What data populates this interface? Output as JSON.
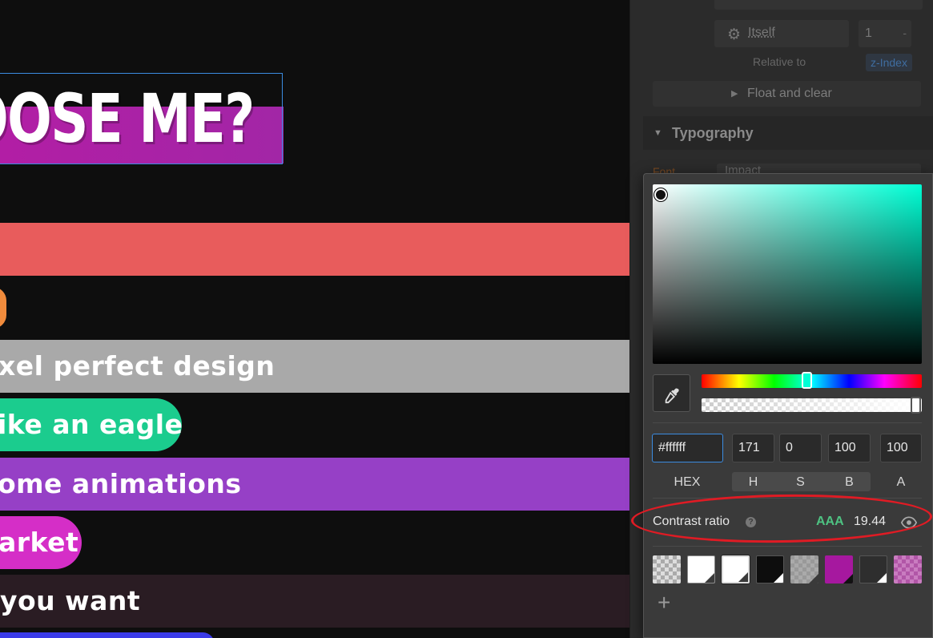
{
  "canvas": {
    "heading": "OOSE ME?",
    "bars": [
      {
        "id": "red",
        "text": ""
      },
      {
        "id": "gray",
        "text": "xel perfect design"
      },
      {
        "id": "green",
        "text": "ike an eagle"
      },
      {
        "id": "purple",
        "text": "ome animations"
      },
      {
        "id": "pink",
        "text": "arket"
      },
      {
        "id": "dark",
        "text": "you want"
      }
    ]
  },
  "panel": {
    "position": {
      "relative_source": "Itself",
      "z_value": "1",
      "z_minus": "-",
      "relative_to_label": "Relative to",
      "z_index_label": "z-Index"
    },
    "float_clear": "Float and clear",
    "typography": {
      "title": "Typography",
      "font_label": "Font",
      "font_value": "Impact"
    }
  },
  "picker": {
    "hue": 171,
    "hex": "#ffffff",
    "h": "171",
    "s": "0",
    "b": "100",
    "a": "100",
    "labels": {
      "hex": "HEX",
      "h": "H",
      "s": "S",
      "b": "B",
      "a": "A"
    },
    "contrast": {
      "label": "Contrast ratio",
      "level": "AAA",
      "value": "19.44"
    },
    "swatches": [
      {
        "name": "transparent",
        "color": "transparent"
      },
      {
        "name": "white",
        "color": "#ffffff"
      },
      {
        "name": "white-selected",
        "color": "#ffffff"
      },
      {
        "name": "black",
        "color": "#0d0d0d"
      },
      {
        "name": "gray-transparent",
        "color": "#888888"
      },
      {
        "name": "magenta",
        "color": "#a6189f"
      },
      {
        "name": "dark-gray",
        "color": "#2e2e2e"
      },
      {
        "name": "pink-transparent",
        "color": "#c266b8"
      }
    ],
    "add_label": "+"
  },
  "colors": {
    "accent": "#3b8be0",
    "aaa_green": "#4ec282",
    "annotation_red": "#e01b24"
  }
}
